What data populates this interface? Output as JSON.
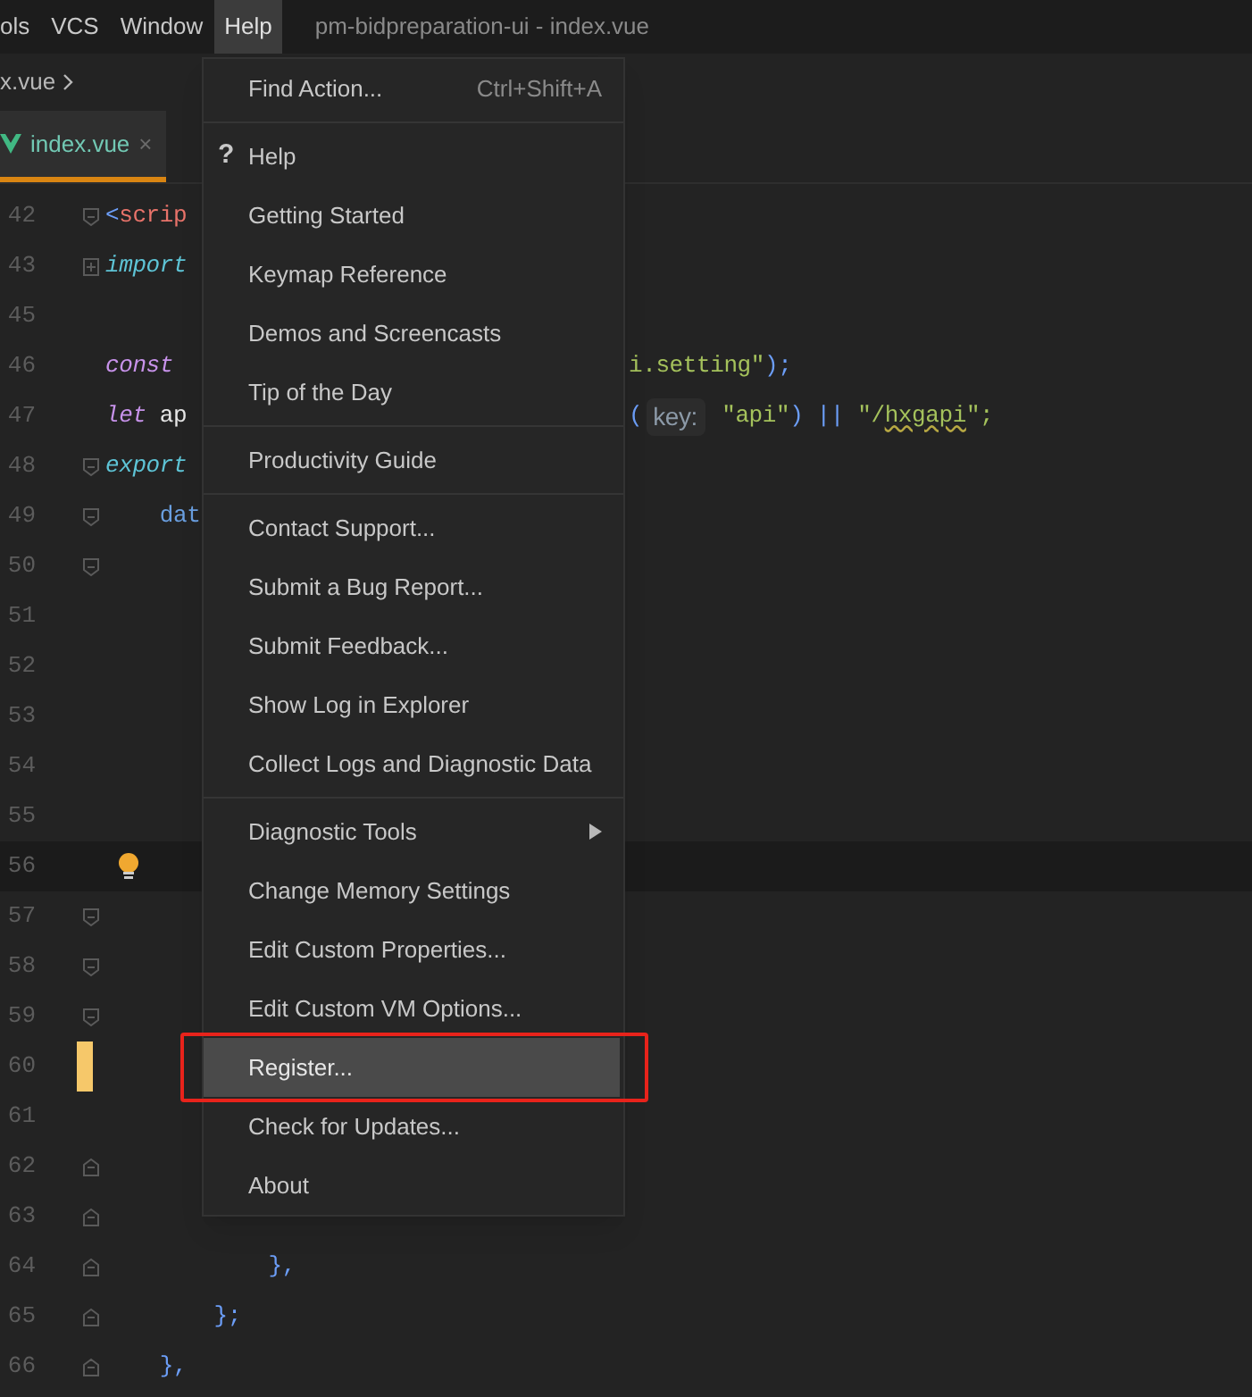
{
  "menu_bar": {
    "items": [
      {
        "label": "ols",
        "selected": false
      },
      {
        "label": "VCS",
        "selected": false
      },
      {
        "label": "Window",
        "selected": false
      },
      {
        "label": "Help",
        "selected": true
      }
    ],
    "title": "pm-bidpreparation-ui - index.vue"
  },
  "breadcrumb": {
    "label": "x.vue"
  },
  "tabs": [
    {
      "label": "index.vue",
      "selected": true,
      "close": "×"
    }
  ],
  "editor": {
    "lines": [
      {
        "number": "42",
        "fold_start": true,
        "left": [
          {
            "text": "<",
            "kind": "punct"
          },
          {
            "text": "scrip",
            "kind": "tag"
          }
        ]
      },
      {
        "number": "43",
        "collapsed": true,
        "left": [
          {
            "text": "import",
            "kind": "keyword"
          }
        ]
      },
      {
        "number": "45"
      },
      {
        "number": "46",
        "left": [
          {
            "text": "const",
            "kind": "storage"
          }
        ],
        "right": [
          {
            "text": "i.setting\"",
            "kind": "string"
          },
          {
            "text": ");",
            "kind": "punct"
          }
        ]
      },
      {
        "number": "47",
        "left": [
          {
            "text": "let",
            "kind": "storage"
          },
          {
            "text": " ap",
            "kind": "plain"
          }
        ],
        "right": [
          {
            "text": "(",
            "kind": "punct"
          },
          {
            "text": "key:",
            "kind": "hint"
          },
          {
            "text": " \"api\"",
            "kind": "string"
          },
          {
            "text": ") || ",
            "kind": "punct"
          },
          {
            "text": "\"/",
            "kind": "string"
          },
          {
            "text": "hxgapi",
            "kind": "typo"
          },
          {
            "text": "\";",
            "kind": "string"
          }
        ]
      },
      {
        "number": "48",
        "fold_start": true,
        "left": [
          {
            "text": "export",
            "kind": "keyword"
          }
        ]
      },
      {
        "number": "49",
        "fold_start": true,
        "left": [
          {
            "text": "    dat",
            "kind": "property"
          }
        ]
      },
      {
        "number": "50",
        "fold_start": true
      },
      {
        "number": "51"
      },
      {
        "number": "52"
      },
      {
        "number": "53"
      },
      {
        "number": "54"
      },
      {
        "number": "55"
      },
      {
        "number": "56",
        "caret": true,
        "bulb": true
      },
      {
        "number": "57",
        "fold_start": true
      },
      {
        "number": "58",
        "fold_start": true
      },
      {
        "number": "59",
        "fold_start": true
      },
      {
        "number": "60",
        "changed": true
      },
      {
        "number": "61"
      },
      {
        "number": "62",
        "fold_end": true
      },
      {
        "number": "63",
        "fold_end": true
      },
      {
        "number": "64",
        "fold_end": true,
        "left": [
          {
            "text": "            },",
            "kind": "punct"
          }
        ]
      },
      {
        "number": "65",
        "fold_end": true,
        "left": [
          {
            "text": "        };",
            "kind": "punct"
          }
        ]
      },
      {
        "number": "66",
        "fold_end": true,
        "left": [
          {
            "text": "    },",
            "kind": "punct"
          }
        ]
      }
    ]
  },
  "help_menu": {
    "groups": [
      [
        {
          "label": "Find Action...",
          "shortcut": "Ctrl+Shift+A",
          "kind": "plain",
          "selected": false,
          "annotated": false
        }
      ],
      [
        {
          "label": "Help",
          "icon": "?",
          "kind": "plain",
          "selected": false,
          "annotated": false
        },
        {
          "label": "Getting Started",
          "kind": "plain",
          "selected": false,
          "annotated": false
        },
        {
          "label": "Keymap Reference",
          "kind": "plain",
          "selected": false,
          "annotated": false
        },
        {
          "label": "Demos and Screencasts",
          "kind": "plain",
          "selected": false,
          "annotated": false
        },
        {
          "label": "Tip of the Day",
          "kind": "plain",
          "selected": false,
          "annotated": false
        }
      ],
      [
        {
          "label": "Productivity Guide",
          "kind": "plain",
          "selected": false,
          "annotated": false
        }
      ],
      [
        {
          "label": "Contact Support...",
          "kind": "plain",
          "selected": false,
          "annotated": false
        },
        {
          "label": "Submit a Bug Report...",
          "kind": "plain",
          "selected": false,
          "annotated": false
        },
        {
          "label": "Submit Feedback...",
          "kind": "plain",
          "selected": false,
          "annotated": false
        },
        {
          "label": "Show Log in Explorer",
          "kind": "plain",
          "selected": false,
          "annotated": false
        },
        {
          "label": "Collect Logs and Diagnostic Data",
          "kind": "plain",
          "selected": false,
          "annotated": false
        }
      ],
      [
        {
          "label": "Diagnostic Tools",
          "kind": "submenu",
          "selected": false,
          "annotated": false
        },
        {
          "label": "Change Memory Settings",
          "kind": "plain",
          "selected": false,
          "annotated": false
        },
        {
          "label": "Edit Custom Properties...",
          "kind": "plain",
          "selected": false,
          "annotated": false
        },
        {
          "label": "Edit Custom VM Options...",
          "kind": "plain",
          "selected": false,
          "annotated": false
        },
        {
          "label": "Register...",
          "kind": "plain",
          "selected": true,
          "annotated": true
        },
        {
          "label": "Check for Updates...",
          "kind": "plain",
          "selected": false,
          "annotated": false
        },
        {
          "label": "About",
          "kind": "plain",
          "selected": false,
          "annotated": false
        }
      ]
    ]
  }
}
